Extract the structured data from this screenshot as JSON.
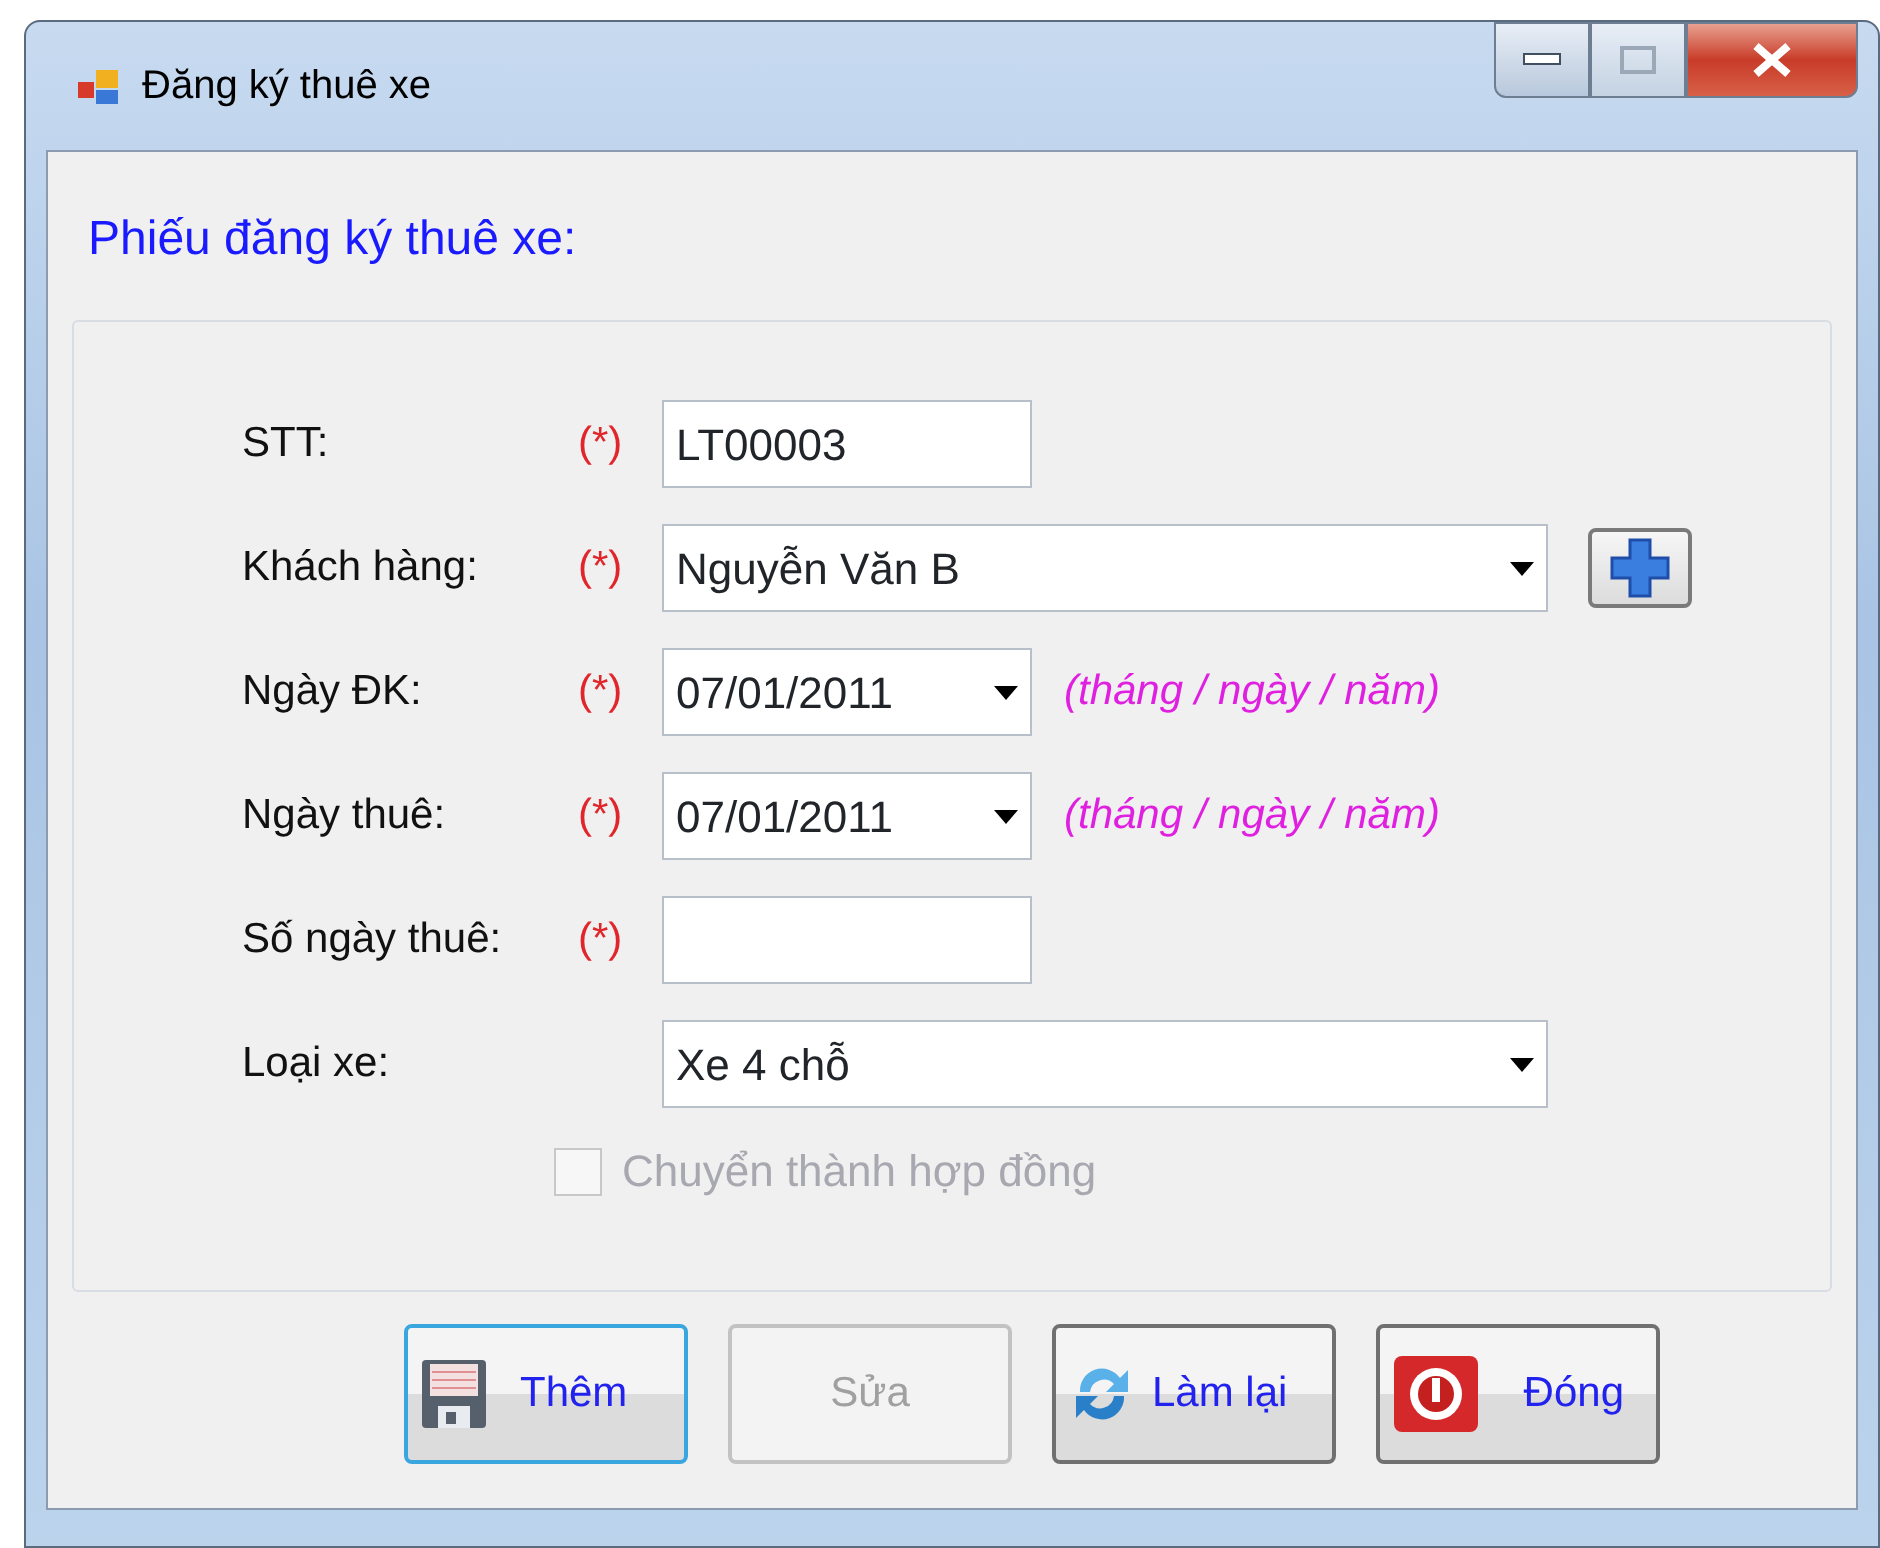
{
  "window": {
    "title": "Đăng ký thuê xe"
  },
  "heading": "Phiếu đăng ký thuê xe:",
  "fields": [
    {
      "label": "STT:",
      "required": true,
      "required_mark": "(*)",
      "kind": "text",
      "value": "LT00003"
    },
    {
      "label": "Khách hàng:",
      "required": true,
      "required_mark": "(*)",
      "kind": "combo",
      "value": "Nguyễn Văn B",
      "add_button": true
    },
    {
      "label": "Ngày ĐK:",
      "required": true,
      "required_mark": "(*)",
      "kind": "date",
      "value": "07/01/2011",
      "hint": "(tháng / ngày / năm)"
    },
    {
      "label": "Ngày thuê:",
      "required": true,
      "required_mark": "(*)",
      "kind": "date",
      "value": "07/01/2011",
      "hint": "(tháng / ngày / năm)"
    },
    {
      "label": "Số ngày thuê:",
      "required": true,
      "required_mark": "(*)",
      "kind": "text"
    },
    {
      "label": "Loại xe:",
      "required": false,
      "kind": "combo",
      "value": "Xe 4 chỗ"
    }
  ],
  "checkbox": {
    "label": "Chuyển thành hợp đồng",
    "checked": false,
    "disabled": true
  },
  "buttons": [
    {
      "label": "Thêm",
      "focused": true,
      "disabled": false
    },
    {
      "label": "Sửa",
      "focused": false,
      "disabled": true
    },
    {
      "label": "Làm lại",
      "focused": false,
      "disabled": false
    },
    {
      "label": "Đóng",
      "focused": false,
      "disabled": false
    }
  ]
}
